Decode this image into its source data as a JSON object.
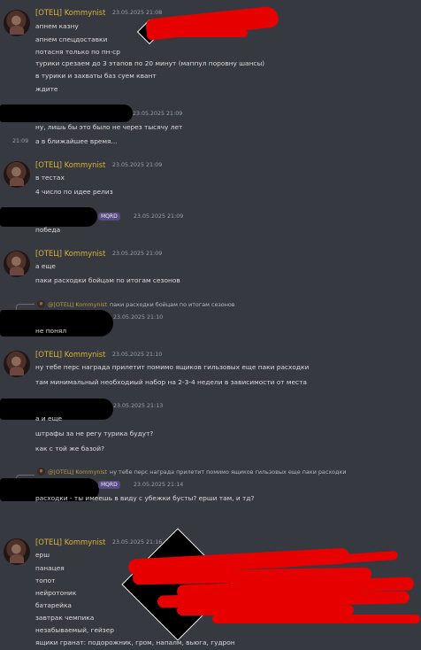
{
  "messages": [
    {
      "author": "[ОТЕЦ] Kommynist",
      "timestamp": "23.05.2025 21:08",
      "lines": [
        "апнем казну",
        "апнем спецдоставки",
        "потасня только по пн-ср",
        "турики срезаем до 3 этапов по 20 минут (маппул поровну шансы)",
        "в турики и захваты баз суем квант",
        "ждите"
      ]
    },
    {
      "author": "",
      "timestamp": "23.05.2025 21:09",
      "lines": [
        "ну, лишь бы это было не через тысячу лет",
        "а в ближайшее время..."
      ],
      "line_time": "21:09"
    },
    {
      "author": "[ОТЕЦ] Kommynist",
      "timestamp": "23.05.2025 21:09",
      "lines": [
        "в тестах",
        "4 число по идее релиз"
      ]
    },
    {
      "author": "",
      "badge": "MQRD",
      "timestamp": "23.05.2025 21:09",
      "lines": [
        "победа"
      ]
    },
    {
      "author": "[ОТЕЦ] Kommynist",
      "timestamp": "23.05.2025 21:09",
      "lines": [
        "а еще",
        "паки расходки бойцам по итогам сезонов"
      ]
    },
    {
      "reply": {
        "name": "@[ОТЕЦ] Kommynist",
        "text": "паки расходки бойцам по итогам сезонов"
      },
      "author": "",
      "timestamp": "23.05.2025 21:10",
      "lines": [
        "не понял"
      ]
    },
    {
      "author": "[ОТЕЦ] Kommynist",
      "timestamp": "23.05.2025 21:10",
      "lines": [
        "ну тебе перс награда прилетит помимо ящиков гильзовых еще паки расходки",
        "там минимальный необходиый набор на 2-3-4 недели в зависимости от места"
      ]
    },
    {
      "author": "",
      "timestamp": "23.05.2025 21:13",
      "lines": [
        "а и еще",
        "штрафы за не регу турика будут?",
        "как с той же базой?"
      ]
    },
    {
      "reply": {
        "name": "@[ОТЕЦ] Kommynist",
        "text": "ну тебе перс награда прилетит помимо ящиков гильзовых еще паки расходки"
      },
      "author": "",
      "badge": "MQRD",
      "timestamp": "23.05.2025 21:14",
      "lines": [
        "расходки - ты имеешь в виду с убежки бусты? ерши там, и тд?"
      ]
    },
    {
      "author": "[ОТЕЦ] Kommynist",
      "timestamp": "23.05.2025 21:16",
      "lines": [
        "ерш",
        "панацея",
        "топот",
        "нейротоник",
        "батарейка",
        "завтрак чемпика",
        "незабываемый, гейзер",
        "ящики гранат: подорожник, гром, напалм, вьюга, гудрон"
      ]
    }
  ],
  "colors": {
    "background": "#36393f",
    "author": "#d7b23a",
    "text": "#dcddde",
    "timestamp": "#9da0a6",
    "redaction": "#e60000"
  },
  "icons": [
    "avatar",
    "reply-avatar",
    "badge-icon"
  ]
}
